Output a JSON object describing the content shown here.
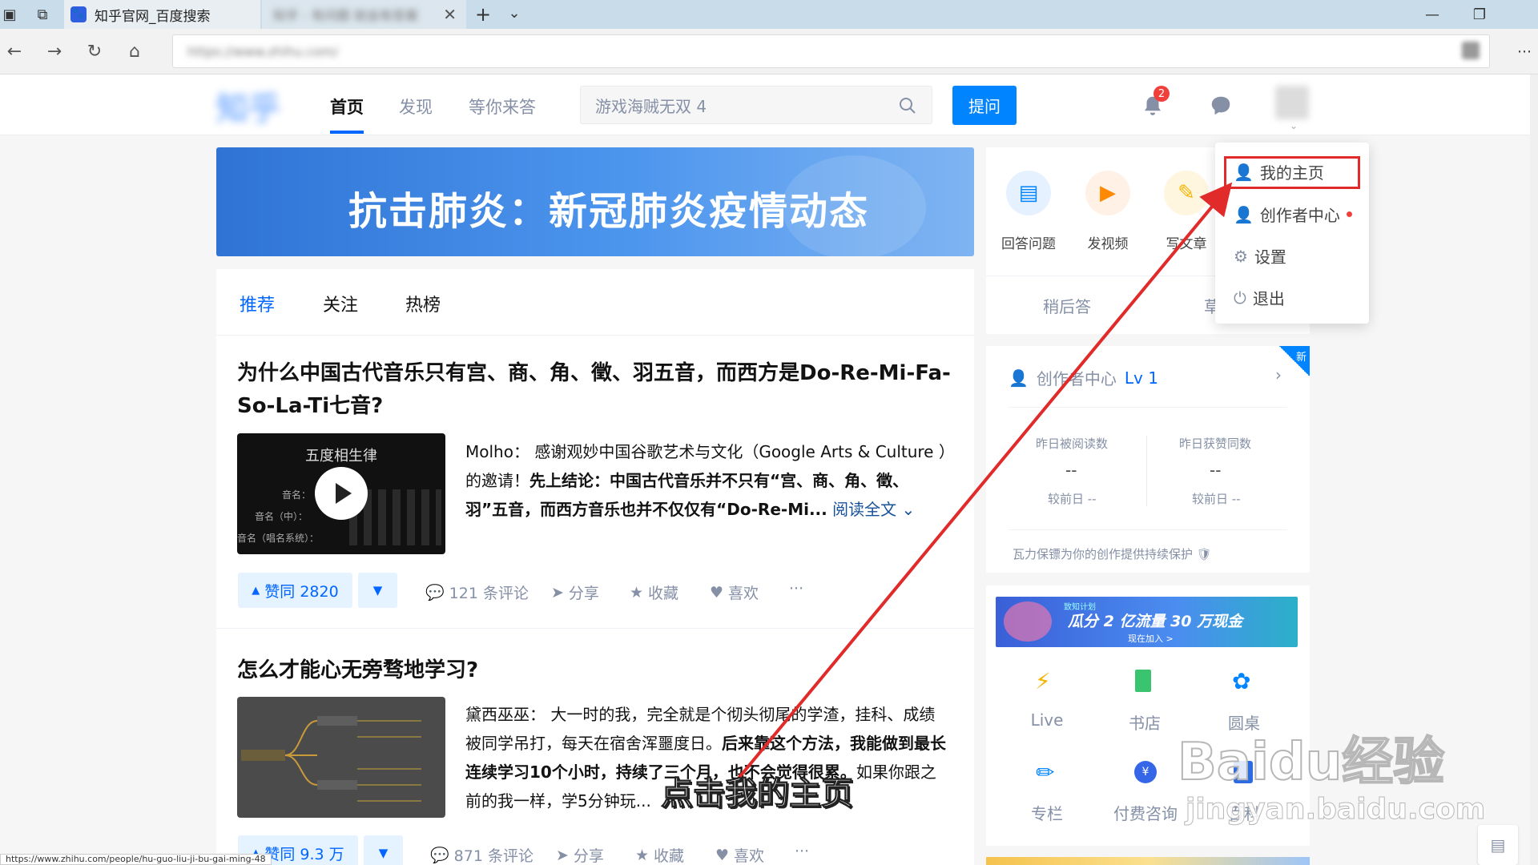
{
  "browser": {
    "tab_title": "知乎官网_百度搜索",
    "tab2_title": "知乎 - 有问题 就会有答案",
    "address": "https://www.zhihu.com/",
    "new_tab": "+",
    "tab_list": "⌄",
    "status_url": "https://www.zhihu.com/people/hu-guo-liu-ji-bu-gai-ming-48"
  },
  "header": {
    "logo": "知乎",
    "nav": [
      "首页",
      "发现",
      "等你来答"
    ],
    "search_placeholder": "游戏海贼无双 4",
    "ask_label": "提问",
    "notification_count": "2"
  },
  "banner": {
    "title": "抗击肺炎：新冠肺炎疫情动态"
  },
  "feed_tabs": [
    "推荐",
    "关注",
    "热榜"
  ],
  "feed": [
    {
      "title": "为什么中国古代音乐只有宫、商、角、徵、羽五音，而西方是Do-Re-Mi-Fa-So-La-Ti七音?",
      "thumb_title": "五度相生律",
      "thumb_rows": [
        "音名：",
        "音名（中）：",
        "音名（唱名系统）："
      ],
      "author": "Molho：",
      "excerpt_a": "感谢观妙中国谷歌艺术与文化（Google Arts & Culture ）的邀请！",
      "excerpt_b": "先上结论：中国古代音乐并不只有“宫、商、角、徵、羽”五音，而西方音乐也并不仅仅有“Do-Re-Mi...",
      "read_more": "阅读全文",
      "vote": "赞同 2820",
      "comments": "121 条评论",
      "share": "分享",
      "collect": "收藏",
      "like": "喜欢",
      "more": "···"
    },
    {
      "title": "怎么才能心无旁骛地学习?",
      "author": "黛西巫巫：",
      "excerpt_a": "大一时的我，完全就是个彻头彻尾的学渣，挂科、成绩被同学吊打，每天在宿舍浑噩度日。",
      "excerpt_b": "后来靠这个方法，我能做到最长连续学习10个小时，持续了三个月，也不会觉得很累。",
      "excerpt_c": "如果你跟之前的我一样，学5分钟玩...",
      "vote": "赞同 9.3 万",
      "comments": "871 条评论",
      "share": "分享",
      "collect": "收藏",
      "like": "喜欢",
      "more": "···"
    }
  ],
  "right": {
    "actions": [
      "回答问题",
      "发视频",
      "写文章"
    ],
    "later": "稍后答",
    "drafts": "草稿箱",
    "creator_title": "创作者中心",
    "level": "Lv 1",
    "new_tag": "新",
    "stat1_label": "昨日被阅读数",
    "stat2_label": "昨日获赞同数",
    "stat_value": "--",
    "compare": "较前日 --",
    "protect": "瓦力保镖为你的创作提供持续保护",
    "ad_kicker": "致知计划",
    "ad_text": "瓜分 2 亿流量 30 万现金",
    "ad_sub": "现在加入 >",
    "grid": [
      "Live",
      "书店",
      "圆桌",
      "专栏",
      "付费咨询",
      "百科"
    ]
  },
  "menu": {
    "items": [
      "我的主页",
      "创作者中心",
      "设置",
      "退出"
    ]
  },
  "annotation": {
    "caption": "点击我的主页"
  },
  "watermark": {
    "brand": "Baidu经验",
    "url": "jingyan.baidu.com"
  },
  "colors": {
    "zhihu_blue": "#0066ff",
    "ask_blue": "#0084ff",
    "annotation_red": "#e12a2a"
  }
}
